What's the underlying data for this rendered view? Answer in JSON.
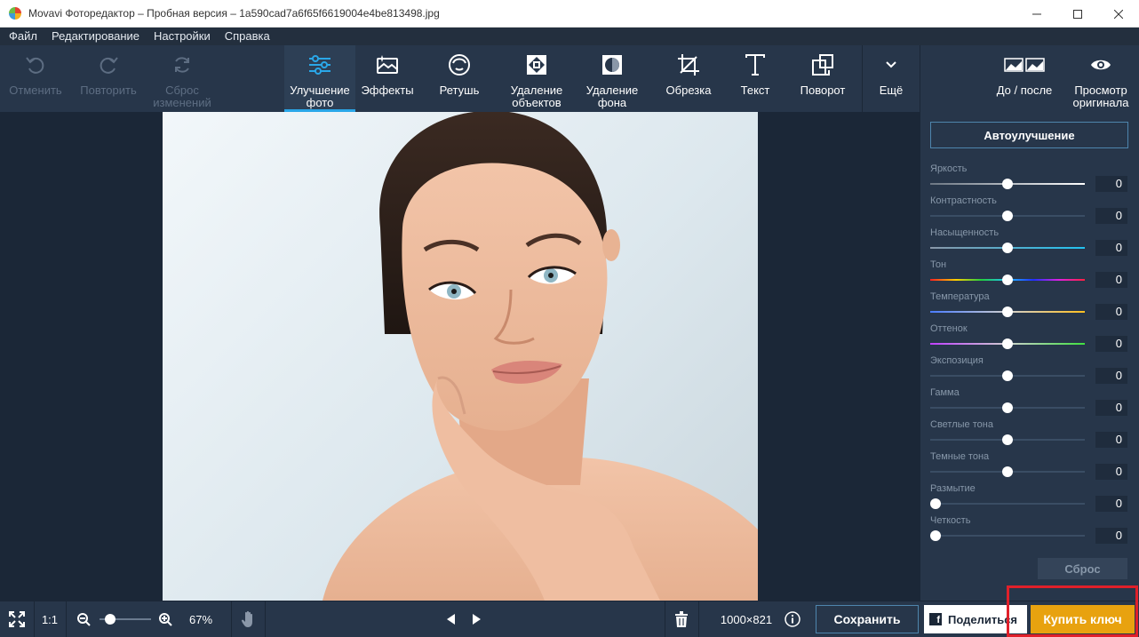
{
  "window": {
    "title": "Movavi Фоторедактор – Пробная версия – 1a590cad7a6f65f6619004e4be813498.jpg",
    "minimize_icon": "minimize-icon",
    "maximize_icon": "maximize-icon",
    "close_icon": "close-icon"
  },
  "menu": [
    "Файл",
    "Редактирование",
    "Настройки",
    "Справка"
  ],
  "toolbar": {
    "undo": "Отменить",
    "redo": "Повторить",
    "reset_changes": "Сброс изменений",
    "enhance": "Улучшение фото",
    "effects": "Эффекты",
    "retouch": "Ретушь",
    "remove_objects": "Удаление объектов",
    "remove_bg": "Удаление фона",
    "crop": "Обрезка",
    "text": "Текст",
    "rotate": "Поворот",
    "more": "Ещё",
    "before_after": "До / после",
    "view_original": "Просмотр оригинала",
    "active_tool": "Улучшение фото",
    "accent_color": "#2aa7e8"
  },
  "panel": {
    "auto_enhance": "Автоулучшение",
    "reset": "Сброс",
    "sliders": [
      {
        "label": "Яркость",
        "value": "0",
        "level": 0.5,
        "track": "brightness"
      },
      {
        "label": "Контрастность",
        "value": "0",
        "level": 0.5,
        "track": "contrast"
      },
      {
        "label": "Насыщенность",
        "value": "0",
        "level": 0.5,
        "track": "saturation"
      },
      {
        "label": "Тон",
        "value": "0",
        "level": 0.5,
        "track": "hue"
      },
      {
        "label": "Температура",
        "value": "0",
        "level": 0.5,
        "track": "temperature"
      },
      {
        "label": "Оттенок",
        "value": "0",
        "level": 0.5,
        "track": "tint"
      },
      {
        "label": "Экспозиция",
        "value": "0",
        "level": 0.5,
        "track": "plain"
      },
      {
        "label": "Гамма",
        "value": "0",
        "level": 0.5,
        "track": "plain"
      },
      {
        "label": "Светлые тона",
        "value": "0",
        "level": 0.5,
        "track": "plain"
      },
      {
        "label": "Темные тона",
        "value": "0",
        "level": 0.5,
        "track": "plain"
      },
      {
        "label": "Размытие",
        "value": "0",
        "level": 0.0,
        "track": "plain"
      },
      {
        "label": "Четкость",
        "value": "0",
        "level": 0.0,
        "track": "plain"
      }
    ]
  },
  "bottom": {
    "actual_size": "1:1",
    "zoom": "67%",
    "zoom_level": 0.1,
    "dimensions": "1000×821",
    "save": "Сохранить",
    "share": "Поделиться",
    "buy": "Купить ключ",
    "buy_color": "#e8a20f",
    "highlight_color": "#e0202a"
  }
}
